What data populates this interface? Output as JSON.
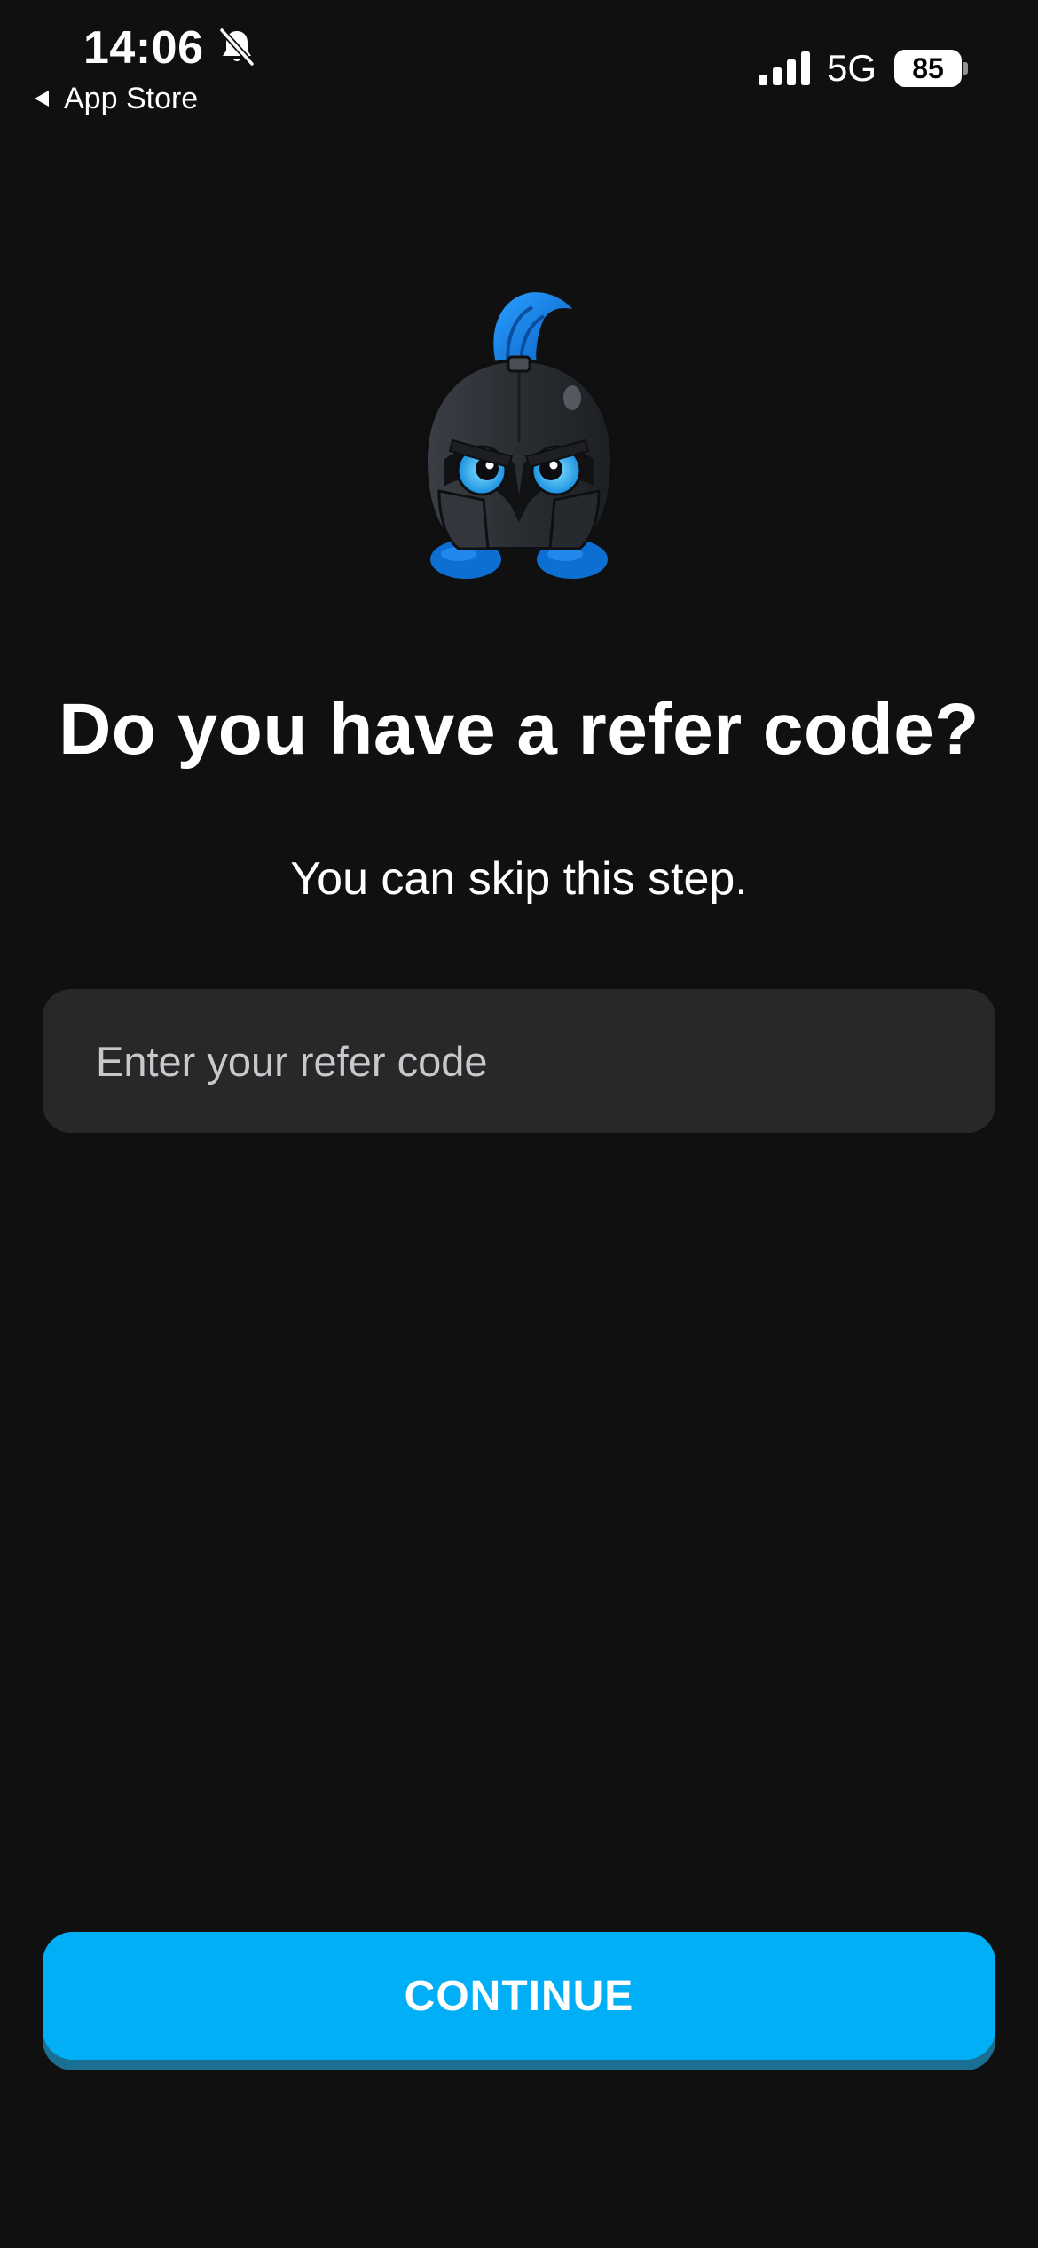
{
  "status_bar": {
    "time": "14:06",
    "back_app": "App Store",
    "network": "5G",
    "battery": "85",
    "icons": [
      "bell-slash-icon",
      "back-triangle-icon",
      "cellular-signal-icon",
      "battery-icon"
    ]
  },
  "mascot": {
    "icon": "knight-helmet-mascot",
    "accent_color": "#1e8fe3"
  },
  "title": "Do you have a refer code?",
  "subtitle": "You can skip this step.",
  "refer_input": {
    "value": "",
    "placeholder": "Enter your refer code"
  },
  "continue_button": {
    "label": "CONTINUE",
    "color": "#00aff5"
  },
  "colors": {
    "background": "#101011",
    "input_background": "#28282b"
  }
}
